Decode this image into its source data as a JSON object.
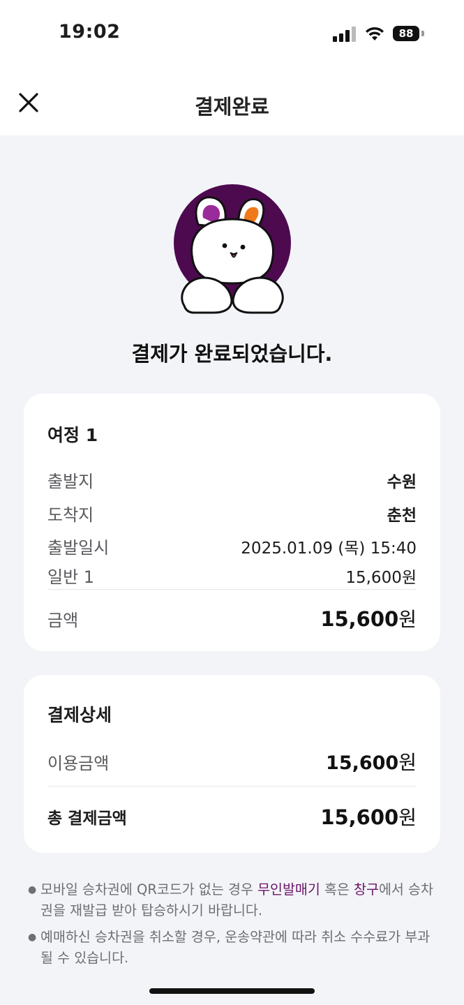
{
  "status_bar": {
    "time": "19:02",
    "battery": "88"
  },
  "header": {
    "title": "결제완료"
  },
  "headline": "결제가 완료되었습니다.",
  "trip": {
    "title": "여정 1",
    "rows": [
      {
        "label": "출발지",
        "value": "수원"
      },
      {
        "label": "도착지",
        "value": "춘천"
      },
      {
        "label": "출발일시",
        "value": "2025.01.09 (목) 15:40"
      },
      {
        "label": "일반 1",
        "value": "15,600원"
      }
    ],
    "amount_label": "금액",
    "amount_value": "15,600",
    "amount_unit": "원"
  },
  "payment": {
    "title": "결제상세",
    "usage_label": "이용금액",
    "usage_value": "15,600",
    "usage_unit": "원",
    "total_label": "총 결제금액",
    "total_value": "15,600",
    "total_unit": "원"
  },
  "notes": {
    "note1_part1": "모바일 승차권에 QR코드가 없는 경우 ",
    "note1_link1": "무인발매기",
    "note1_part2": " 혹은 ",
    "note1_link2": "창구",
    "note1_part3": "에서 승차권을 재발급 받아 탑승하시기 바랍니다.",
    "note2": "예매하신 승차권을 취소할 경우, 운송약관에 따라 취소 수수료가 부과될 수 있습니다."
  },
  "colors": {
    "accent": "#6b1467",
    "mascot_bg": "#4d0a4f",
    "ear_purple": "#9a2b9a",
    "ear_orange": "#f07a1a"
  },
  "icons": {
    "close": "close-icon",
    "mascot": "rabbit-mascot",
    "signal": "cellular-signal-icon",
    "wifi": "wifi-icon",
    "battery": "battery-icon"
  }
}
